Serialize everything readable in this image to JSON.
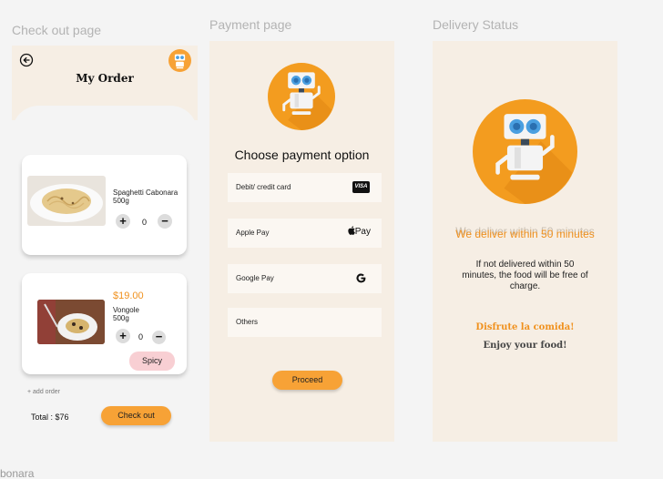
{
  "frames": {
    "checkout_label": "Check out page",
    "payment_label": "Payment page",
    "delivery_label": "Delivery Status"
  },
  "checkout": {
    "title": "My Order",
    "items": [
      {
        "name": "Spaghetti Cabonara",
        "weight": "500g",
        "qty": "0",
        "price": ""
      },
      {
        "name": "Vongole",
        "weight": "500g",
        "qty": "0",
        "price": "$19.00",
        "tag": "Spicy"
      }
    ],
    "plus": "+",
    "minus": "−",
    "add_order": "+ add order",
    "total": "Total : $76",
    "checkout_button": "Check out"
  },
  "payment": {
    "title": "Choose payment option",
    "options": [
      {
        "label": "Debit/ credit card",
        "icon": "visa-card-icon"
      },
      {
        "label": "Apple Pay",
        "icon": "apple-pay-icon"
      },
      {
        "label": "Google Pay",
        "icon": "google-icon"
      },
      {
        "label": "Others",
        "icon": ""
      }
    ],
    "visa_text": "VISA",
    "applepay_text": "Pay",
    "proceed_button": "Proceed"
  },
  "delivery": {
    "headline": "We deliver within 50 minutes",
    "note": "If not delivered within 50 minutes, the food will be free of charge.",
    "spanish": "Disfrute la comida!",
    "english": "Enjoy your food!"
  },
  "bottom_partial": "bonara",
  "colors": {
    "accent": "#f7a236",
    "cream": "#f6eee4",
    "spicy": "#f8cfd3"
  }
}
